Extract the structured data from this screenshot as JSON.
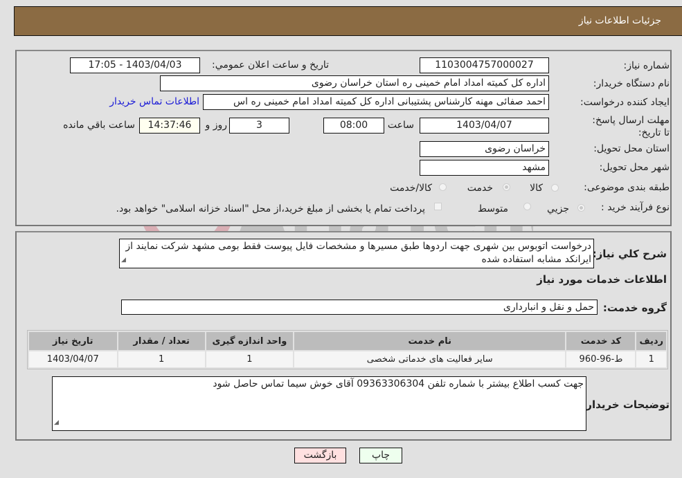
{
  "header": {
    "title": "جزئیات اطلاعات نیاز"
  },
  "form": {
    "need_number": {
      "label": "شماره نیاز:",
      "value": "1103004757000027"
    },
    "announce_datetime": {
      "label": "تاریخ و ساعت اعلان عمومي:",
      "value": "1403/04/03 - 17:05"
    },
    "buyer_org": {
      "label": "نام دستگاه خریدار:",
      "value": "اداره کل کمیته امداد امام خمینی  ره  استان خراسان رضوی"
    },
    "requester": {
      "label": "ایجاد کننده درخواست:",
      "value": "احمد صفائی مهنه کارشناس پشتیبانی اداره کل کمیته امداد امام خمینی  ره  اس"
    },
    "contact_link": "اطلاعات تماس خریدار",
    "deadline": {
      "label": "مهلت ارسال پاسخ: تا تاریخ:",
      "date": "1403/04/07",
      "time_label": "ساعت",
      "time": "08:00",
      "days": "3",
      "days_label": "روز و",
      "remaining": "14:37:46",
      "remaining_label": "ساعت باقي مانده"
    },
    "delivery_province": {
      "label": "استان محل تحویل:",
      "value": "خراسان رضوی"
    },
    "delivery_city": {
      "label": "شهر محل تحویل:",
      "value": "مشهد"
    },
    "category": {
      "label": "طبقه بندی موضوعی:",
      "options": [
        "کالا",
        "خدمت",
        "کالا/خدمت"
      ],
      "selected": "خدمت"
    },
    "purchase_type": {
      "label": "نوع فرآیند خرید :",
      "options": [
        "جزیي",
        "متوسط"
      ],
      "selected": "جزیي",
      "treasury_note": "پرداخت تمام یا بخشی از مبلغ خرید،از محل \"اسناد خزانه اسلامی\" خواهد بود."
    }
  },
  "details": {
    "description_label": "شرح کلي نیاز:",
    "description": "درخواست اتوبوس بین شهری جهت اردوها  طبق مسیرها و مشخصات فایل پیوست فقط بومی مشهد شرکت نمایند از ایرانکد مشابه استفاده شده",
    "services_heading": "اطلاعات خدمات مورد نیاز",
    "service_group_label": "گروه خدمت:",
    "service_group": "حمل و نقل و انبارداری",
    "table": {
      "headers": [
        "ردیف",
        "کد خدمت",
        "نام خدمت",
        "واحد اندازه گیری",
        "تعداد / مقدار",
        "تاریخ نیاز"
      ],
      "rows": [
        [
          "1",
          "ط-96-960",
          "سایر فعالیت های خدماتی شخصی",
          "1",
          "1",
          "1403/04/07"
        ]
      ]
    },
    "buyer_notes_label": "توضیحات خریدار:",
    "buyer_notes": "جهت کسب اطلاع بیشتر با شماره تلفن 09363306304 آقای خوش سیما تماس حاصل شود"
  },
  "buttons": {
    "print": "چاپ",
    "back": "بازگشت"
  },
  "watermark": {
    "text": "AriaTender.neT"
  }
}
